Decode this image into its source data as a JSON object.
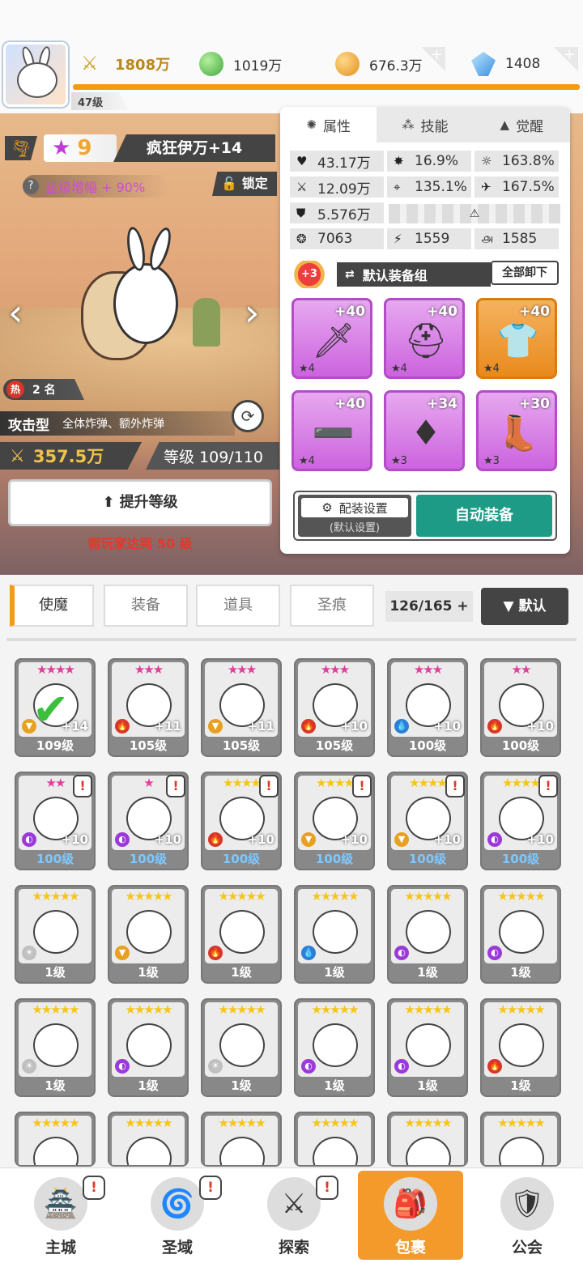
{
  "player": {
    "level": "47级",
    "avatar": "bunny-mascot"
  },
  "resources": [
    {
      "icon": "power-sword-icon",
      "value": "1808万"
    },
    {
      "icon": "green-orb-icon",
      "value": "1019万"
    },
    {
      "icon": "gold-coin-icon",
      "value": "676.3万"
    },
    {
      "icon": "blue-crystal-icon",
      "value": "1408"
    }
  ],
  "hero": {
    "stars": "9",
    "name": "疯狂伊万+14",
    "star_boost": "星级增幅 + 90%",
    "lock_label": "锁定",
    "hot_rank": "2 名",
    "hot_icon": "热",
    "type": "攻击型",
    "skills_desc": "全体炸弹、额外炸弹",
    "power": "357.5万",
    "level_text": "等级 109/110",
    "upgrade_label": "提升等级",
    "upgrade_requirement": "需玩家达到 50 级"
  },
  "panel": {
    "tabs": [
      {
        "label": "属性",
        "icon": "✺"
      },
      {
        "label": "技能",
        "icon": "⁂"
      },
      {
        "label": "觉醒",
        "icon": "▲"
      }
    ],
    "stats": {
      "hp": "43.17万",
      "crit_rate": "16.9%",
      "crit_dmg": "163.8%",
      "atk": "12.09万",
      "accuracy": "135.1%",
      "speed": "167.5%",
      "def": "5.576万",
      "s1": "7063",
      "s2": "1559",
      "s3": "1585"
    },
    "equip_group": {
      "badge": "+3",
      "name": "默认装备组",
      "unload_label": "全部卸下"
    },
    "equipment": [
      {
        "icon": "sword-icon",
        "level": "+40",
        "stars": "★4",
        "rarity": "purple"
      },
      {
        "icon": "helmet-icon",
        "level": "+40",
        "stars": "★4",
        "rarity": "purple"
      },
      {
        "icon": "armor-icon",
        "level": "+40",
        "stars": "★4",
        "rarity": "orange"
      },
      {
        "icon": "belt-icon",
        "level": "+40",
        "stars": "★4",
        "rarity": "purple"
      },
      {
        "icon": "necklace-icon",
        "level": "+34",
        "stars": "★3",
        "rarity": "purple"
      },
      {
        "icon": "boots-icon",
        "level": "+30",
        "stars": "★3",
        "rarity": "purple"
      }
    ],
    "outfit_label": "配装设置",
    "outfit_sub": "(默认设置)",
    "auto_equip_label": "自动装备"
  },
  "inventory": {
    "tabs": [
      "使魔",
      "装备",
      "道具",
      "圣痕"
    ],
    "count": "126/165 +",
    "sort_label": "▼ 默认",
    "cards": [
      {
        "stars": "★★★★",
        "level": "109级",
        "plus": "+14",
        "el": "earth",
        "star_color": "#e0409a"
      },
      {
        "stars": "★★★",
        "level": "105级",
        "plus": "+11",
        "el": "fire",
        "star_color": "#e0409a"
      },
      {
        "stars": "★★★",
        "level": "105级",
        "plus": "+11",
        "el": "earth",
        "star_color": "#e0409a"
      },
      {
        "stars": "★★★",
        "level": "105级",
        "plus": "+10",
        "el": "fire",
        "star_color": "#e0409a"
      },
      {
        "stars": "★★★",
        "level": "100级",
        "plus": "+10",
        "el": "water",
        "star_color": "#e0409a"
      },
      {
        "stars": "★★",
        "level": "100级",
        "plus": "+10",
        "el": "fire",
        "star_color": "#e0409a"
      },
      {
        "stars": "★★",
        "level": "100级",
        "plus": "+10",
        "el": "dark",
        "star_color": "#e0409a",
        "alert": true,
        "blue": true
      },
      {
        "stars": "★",
        "level": "100级",
        "plus": "+10",
        "el": "dark",
        "star_color": "#e0409a",
        "alert": true,
        "blue": true
      },
      {
        "stars": "★★★★",
        "level": "100级",
        "plus": "+10",
        "el": "fire",
        "star_color": "#f5c518",
        "alert": true,
        "blue": true
      },
      {
        "stars": "★★★★",
        "level": "100级",
        "plus": "+10",
        "el": "earth",
        "star_color": "#f5c518",
        "alert": true,
        "blue": true
      },
      {
        "stars": "★★★★",
        "level": "100级",
        "plus": "+10",
        "el": "earth",
        "star_color": "#f5c518",
        "alert": true,
        "blue": true
      },
      {
        "stars": "★★★★",
        "level": "100级",
        "plus": "+10",
        "el": "dark",
        "star_color": "#f5c518",
        "alert": true,
        "blue": true
      },
      {
        "stars": "★★★★★",
        "level": "1级",
        "el": "light",
        "star_color": "#f5c518"
      },
      {
        "stars": "★★★★★",
        "level": "1级",
        "el": "earth",
        "star_color": "#f5c518"
      },
      {
        "stars": "★★★★★",
        "level": "1级",
        "el": "fire",
        "star_color": "#f5c518"
      },
      {
        "stars": "★★★★★",
        "level": "1级",
        "el": "water",
        "star_color": "#f5c518"
      },
      {
        "stars": "★★★★★",
        "level": "1级",
        "el": "dark",
        "star_color": "#f5c518"
      },
      {
        "stars": "★★★★★",
        "level": "1级",
        "el": "dark",
        "star_color": "#f5c518"
      },
      {
        "stars": "★★★★★",
        "level": "1级",
        "el": "light",
        "star_color": "#f5c518"
      },
      {
        "stars": "★★★★★",
        "level": "1级",
        "el": "dark",
        "star_color": "#f5c518"
      },
      {
        "stars": "★★★★★",
        "level": "1级",
        "el": "light",
        "star_color": "#f5c518"
      },
      {
        "stars": "★★★★★",
        "level": "1级",
        "el": "dark",
        "star_color": "#f5c518"
      },
      {
        "stars": "★★★★★",
        "level": "1级",
        "el": "dark",
        "star_color": "#f5c518"
      },
      {
        "stars": "★★★★★",
        "level": "1级",
        "el": "fire",
        "star_color": "#f5c518"
      },
      {
        "stars": "★★★★★",
        "level": "",
        "el": "",
        "star_color": "#f5c518"
      },
      {
        "stars": "★★★★★",
        "level": "",
        "el": "",
        "star_color": "#f5c518"
      },
      {
        "stars": "★★★★★",
        "level": "",
        "el": "",
        "star_color": "#f5c518"
      },
      {
        "stars": "★★★★★",
        "level": "",
        "el": "",
        "star_color": "#f5c518"
      },
      {
        "stars": "★★★★★",
        "level": "",
        "el": "",
        "star_color": "#f5c518"
      },
      {
        "stars": "★★★★★",
        "level": "",
        "el": "",
        "star_color": "#f5c518"
      }
    ]
  },
  "nav": [
    {
      "label": "主城",
      "icon": "castle-icon",
      "alert": true
    },
    {
      "label": "圣域",
      "icon": "vortex-icon",
      "alert": true
    },
    {
      "label": "探索",
      "icon": "sword-stone-icon",
      "alert": true
    },
    {
      "label": "包裹",
      "icon": "bag-icon",
      "active": true
    },
    {
      "label": "公会",
      "icon": "guild-icon"
    }
  ]
}
